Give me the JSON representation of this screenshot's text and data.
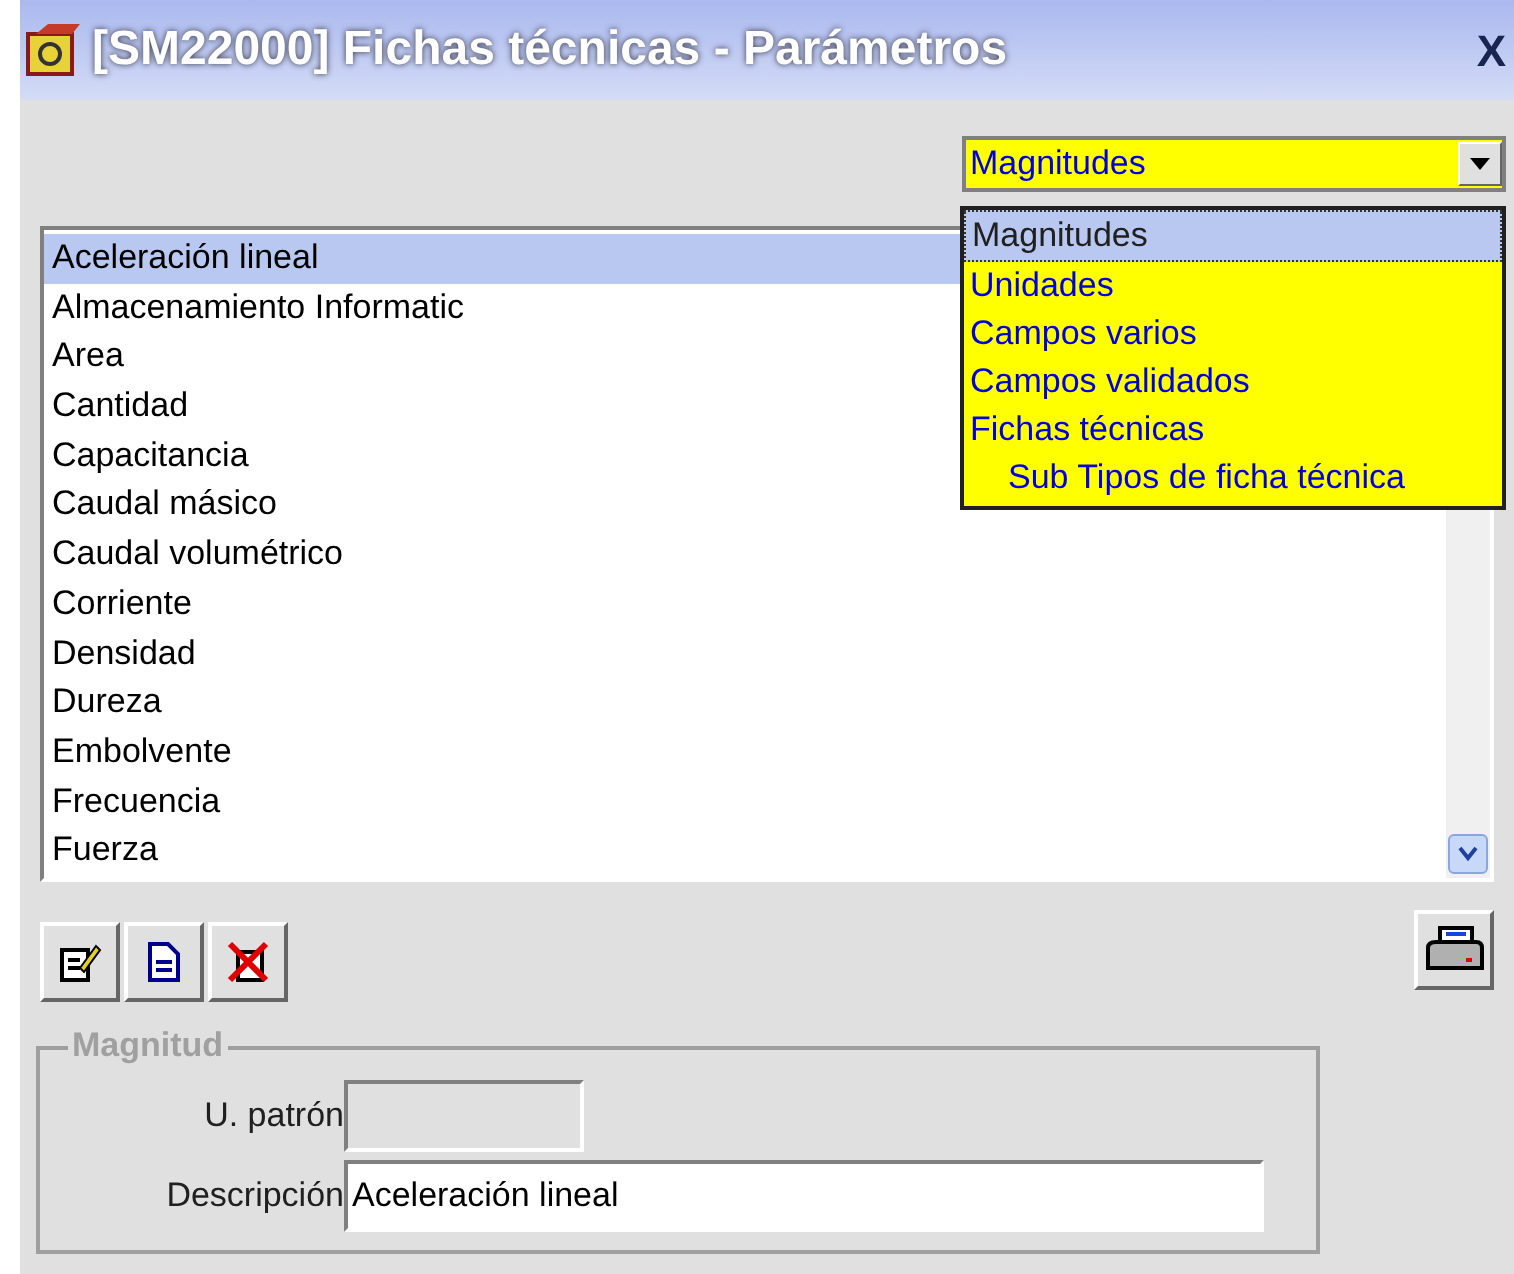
{
  "window": {
    "title": "[SM22000] Fichas técnicas - Parámetros",
    "close": "X"
  },
  "selector": {
    "value": "Magnitudes",
    "expanded": true,
    "options": [
      {
        "label": "Magnitudes",
        "selected": true
      },
      {
        "label": "Unidades",
        "selected": false
      },
      {
        "label": "Campos varios",
        "selected": false
      },
      {
        "label": "Campos validados",
        "selected": false
      },
      {
        "label": "Fichas técnicas",
        "selected": false,
        "children": [
          {
            "label": "Sub Tipos de ficha técnica",
            "selected": false
          }
        ]
      }
    ]
  },
  "list": {
    "items": [
      {
        "label": "Aceleración lineal",
        "selected": true
      },
      {
        "label": "Almacenamiento Informatic",
        "selected": false
      },
      {
        "label": "Area",
        "selected": false
      },
      {
        "label": "Cantidad",
        "selected": false
      },
      {
        "label": "Capacitancia",
        "selected": false
      },
      {
        "label": "Caudal másico",
        "selected": false
      },
      {
        "label": "Caudal volumétrico",
        "selected": false
      },
      {
        "label": "Corriente",
        "selected": false
      },
      {
        "label": "Densidad",
        "selected": false
      },
      {
        "label": "Dureza",
        "selected": false
      },
      {
        "label": "Embolvente",
        "selected": false
      },
      {
        "label": "Frecuencia",
        "selected": false
      },
      {
        "label": "Fuerza",
        "selected": false
      }
    ]
  },
  "group": {
    "title": "Magnitud",
    "fields": [
      {
        "label": "U. patrón",
        "disabled": true
      },
      {
        "label": "Descripción",
        "value": "Aceleración lineal",
        "disabled": false
      }
    ]
  }
}
